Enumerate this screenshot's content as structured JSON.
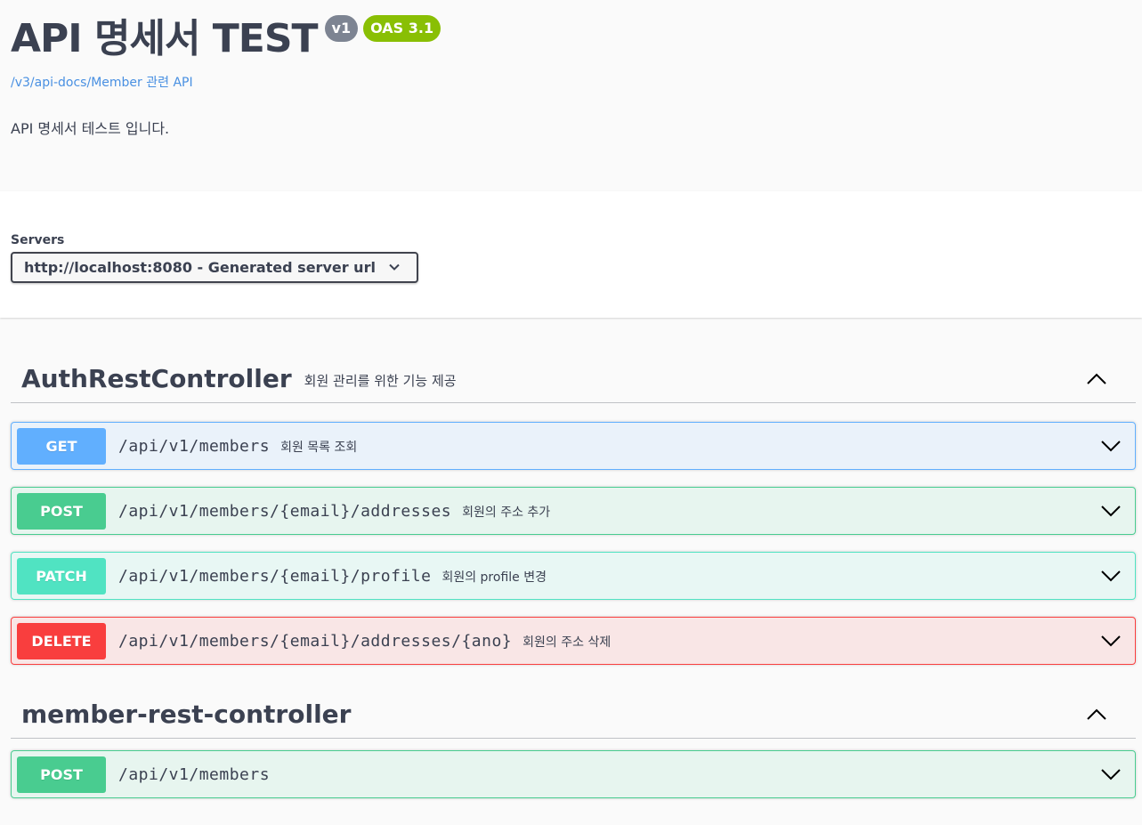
{
  "info": {
    "title": "API 명세서 TEST",
    "version_badge": "v1",
    "oas_badge": "OAS 3.1",
    "spec_link": "/v3/api-docs/Member 관련 API",
    "description": "API 명세서 테스트 입니다."
  },
  "servers": {
    "label": "Servers",
    "selected": "http://localhost:8080 - Generated server url"
  },
  "tags": [
    {
      "name": "AuthRestController",
      "description": "회원 관리를 위한 기능 제공",
      "operations": [
        {
          "method": "GET",
          "path": "/api/v1/members",
          "summary": "회원 목록 조회"
        },
        {
          "method": "POST",
          "path": "/api/v1/members/{email}/addresses",
          "summary": "회원의 주소 추가"
        },
        {
          "method": "PATCH",
          "path": "/api/v1/members/{email}/profile",
          "summary": "회원의 profile 변경"
        },
        {
          "method": "DELETE",
          "path": "/api/v1/members/{email}/addresses/{ano}",
          "summary": "회원의 주소 삭제"
        }
      ]
    },
    {
      "name": "member-rest-controller",
      "description": "",
      "operations": [
        {
          "method": "POST",
          "path": "/api/v1/members",
          "summary": ""
        }
      ]
    }
  ],
  "colors": {
    "get": "#61affe",
    "post": "#49cc90",
    "patch": "#50e3c2",
    "delete": "#f93e3e",
    "version_badge": "#7d8492",
    "oas_badge": "#89bf04",
    "link": "#4990e2"
  },
  "icons": {
    "server_select": "chevron-down-icon",
    "tag_toggle": "chevron-up-icon",
    "op_toggle": "chevron-down-icon"
  }
}
